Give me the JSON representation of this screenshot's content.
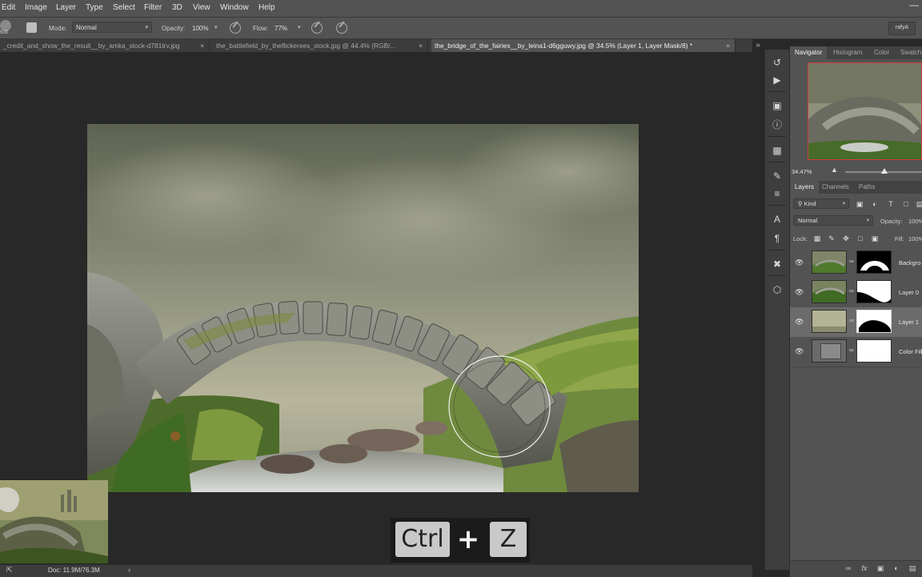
{
  "menu": [
    "Edit",
    "Image",
    "Layer",
    "Type",
    "Select",
    "Filter",
    "3D",
    "View",
    "Window",
    "Help"
  ],
  "options": {
    "brush_size": "500",
    "mode_label": "Mode:",
    "mode_value": "Normal",
    "opacity_label": "Opacity:",
    "opacity_value": "100%",
    "flow_label": "Flow:",
    "flow_value": "77%",
    "workspace": "rafyA"
  },
  "tabs": [
    {
      "label": "_credit_and_show_the_result__by_amka_stock-d781trv.jpg"
    },
    {
      "label": "the_battlefield_by_theflickerees_stock.jpg @ 44.4% (RGB/..."
    },
    {
      "label": "the_bridge_of_the_fairies__by_leina1-d6gguwy.jpg @ 34.5% (Layer 1, Layer Mask/8) *"
    }
  ],
  "status": {
    "doc": "Doc: 11.9M/76.3M"
  },
  "shortcut": {
    "key1": "Ctrl",
    "plus": "+",
    "key2": "Z"
  },
  "navigator": {
    "tabs": [
      "Navigator",
      "Histogram",
      "Color",
      "Swatch"
    ],
    "zoom": "34.47%"
  },
  "layers_panel": {
    "tabs": [
      "Layers",
      "Channels",
      "Paths"
    ],
    "filter": "Kind",
    "blend_mode": "Normal",
    "opacity_label": "Opacity:",
    "opacity_value": "100%",
    "lock_label": "Lock:",
    "fill_label": "Fill:",
    "fill_value": "100%",
    "layers": [
      {
        "name": "Backgro",
        "selected": false
      },
      {
        "name": "Layer 0",
        "selected": false
      },
      {
        "name": "Layer 1",
        "selected": true
      },
      {
        "name": "Color Fill",
        "selected": false
      }
    ]
  },
  "colors": {
    "accent_border": "#c84040",
    "panel_bg": "#535353",
    "canvas_bg": "#282828"
  },
  "icons": [
    "brush-preset-icon",
    "airbrush-icon",
    "pressure-icon",
    "history-icon",
    "play-icon",
    "info-icon",
    "brush-icon",
    "character-icon",
    "paragraph-icon",
    "tool-presets-icon",
    "3d-icon",
    "eye-icon",
    "link-icon",
    "new-layer-icon",
    "delete-icon",
    "fx-icon",
    "mask-icon",
    "adjustment-icon",
    "folder-icon"
  ]
}
